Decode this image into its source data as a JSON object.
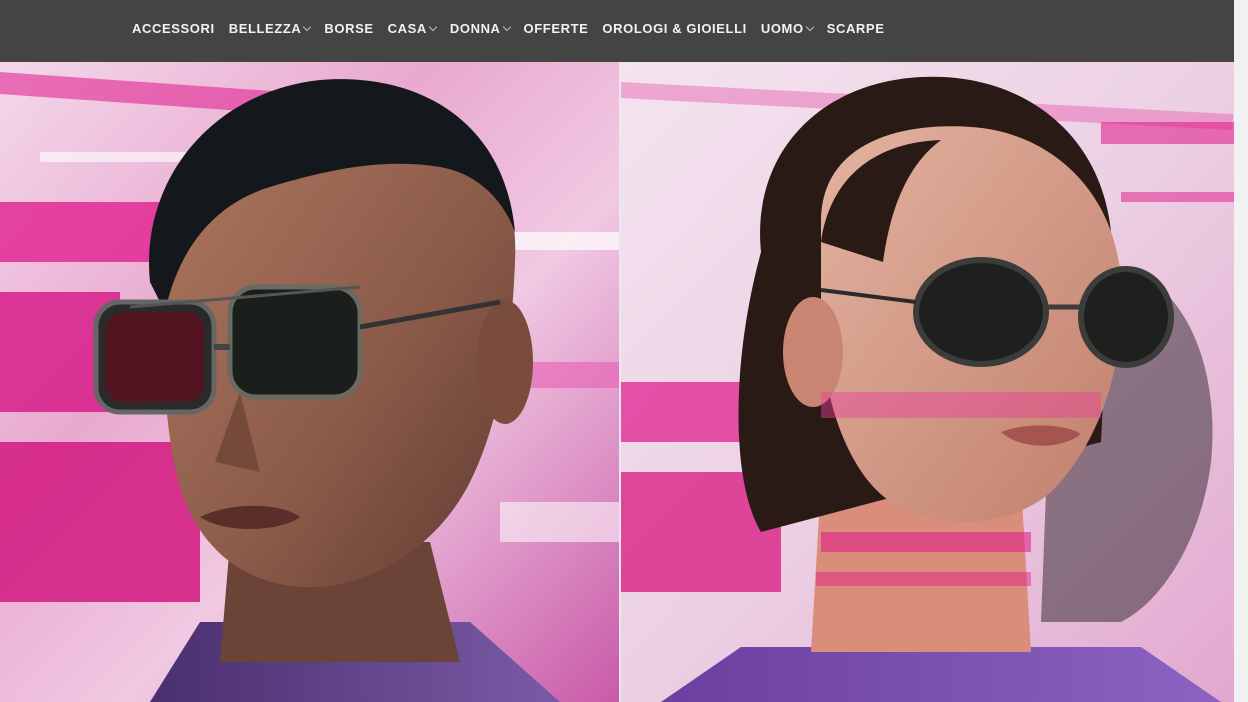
{
  "nav": {
    "items": [
      {
        "label": "ACCESSORI",
        "has_dropdown": false
      },
      {
        "label": "BELLEZZA",
        "has_dropdown": true
      },
      {
        "label": "BORSE",
        "has_dropdown": false
      },
      {
        "label": "CASA",
        "has_dropdown": true
      },
      {
        "label": "DONNA",
        "has_dropdown": true
      },
      {
        "label": "OFFERTE",
        "has_dropdown": false
      },
      {
        "label": "OROLOGI & GIOIELLI",
        "has_dropdown": false
      },
      {
        "label": "UOMO",
        "has_dropdown": true
      },
      {
        "label": "SCARPE",
        "has_dropdown": false
      }
    ]
  },
  "colors": {
    "topbar": "#444444",
    "nav_text": "#f2f2f2",
    "accent_pink": "#e0168a",
    "accent_purple": "#6a3fa0"
  }
}
